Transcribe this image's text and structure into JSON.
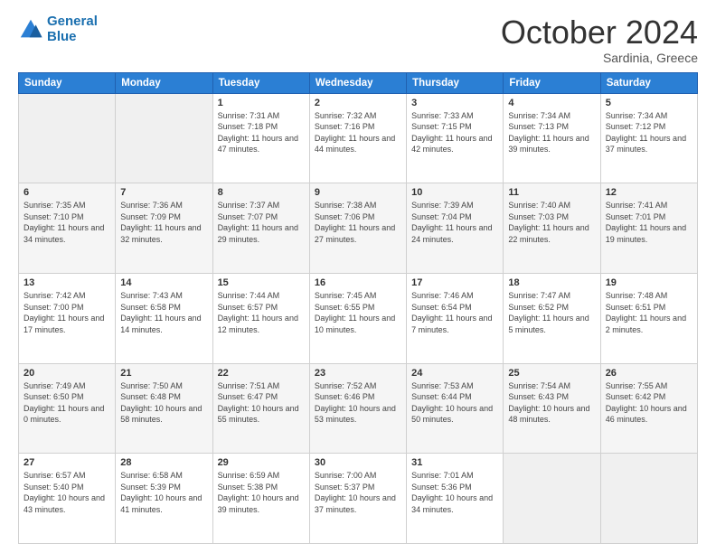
{
  "logo": {
    "line1": "General",
    "line2": "Blue"
  },
  "title": {
    "month": "October 2024",
    "location": "Sardinia, Greece"
  },
  "headers": [
    "Sunday",
    "Monday",
    "Tuesday",
    "Wednesday",
    "Thursday",
    "Friday",
    "Saturday"
  ],
  "weeks": [
    [
      {
        "day": "",
        "sunrise": "",
        "sunset": "",
        "daylight": ""
      },
      {
        "day": "",
        "sunrise": "",
        "sunset": "",
        "daylight": ""
      },
      {
        "day": "1",
        "sunrise": "Sunrise: 7:31 AM",
        "sunset": "Sunset: 7:18 PM",
        "daylight": "Daylight: 11 hours and 47 minutes."
      },
      {
        "day": "2",
        "sunrise": "Sunrise: 7:32 AM",
        "sunset": "Sunset: 7:16 PM",
        "daylight": "Daylight: 11 hours and 44 minutes."
      },
      {
        "day": "3",
        "sunrise": "Sunrise: 7:33 AM",
        "sunset": "Sunset: 7:15 PM",
        "daylight": "Daylight: 11 hours and 42 minutes."
      },
      {
        "day": "4",
        "sunrise": "Sunrise: 7:34 AM",
        "sunset": "Sunset: 7:13 PM",
        "daylight": "Daylight: 11 hours and 39 minutes."
      },
      {
        "day": "5",
        "sunrise": "Sunrise: 7:34 AM",
        "sunset": "Sunset: 7:12 PM",
        "daylight": "Daylight: 11 hours and 37 minutes."
      }
    ],
    [
      {
        "day": "6",
        "sunrise": "Sunrise: 7:35 AM",
        "sunset": "Sunset: 7:10 PM",
        "daylight": "Daylight: 11 hours and 34 minutes."
      },
      {
        "day": "7",
        "sunrise": "Sunrise: 7:36 AM",
        "sunset": "Sunset: 7:09 PM",
        "daylight": "Daylight: 11 hours and 32 minutes."
      },
      {
        "day": "8",
        "sunrise": "Sunrise: 7:37 AM",
        "sunset": "Sunset: 7:07 PM",
        "daylight": "Daylight: 11 hours and 29 minutes."
      },
      {
        "day": "9",
        "sunrise": "Sunrise: 7:38 AM",
        "sunset": "Sunset: 7:06 PM",
        "daylight": "Daylight: 11 hours and 27 minutes."
      },
      {
        "day": "10",
        "sunrise": "Sunrise: 7:39 AM",
        "sunset": "Sunset: 7:04 PM",
        "daylight": "Daylight: 11 hours and 24 minutes."
      },
      {
        "day": "11",
        "sunrise": "Sunrise: 7:40 AM",
        "sunset": "Sunset: 7:03 PM",
        "daylight": "Daylight: 11 hours and 22 minutes."
      },
      {
        "day": "12",
        "sunrise": "Sunrise: 7:41 AM",
        "sunset": "Sunset: 7:01 PM",
        "daylight": "Daylight: 11 hours and 19 minutes."
      }
    ],
    [
      {
        "day": "13",
        "sunrise": "Sunrise: 7:42 AM",
        "sunset": "Sunset: 7:00 PM",
        "daylight": "Daylight: 11 hours and 17 minutes."
      },
      {
        "day": "14",
        "sunrise": "Sunrise: 7:43 AM",
        "sunset": "Sunset: 6:58 PM",
        "daylight": "Daylight: 11 hours and 14 minutes."
      },
      {
        "day": "15",
        "sunrise": "Sunrise: 7:44 AM",
        "sunset": "Sunset: 6:57 PM",
        "daylight": "Daylight: 11 hours and 12 minutes."
      },
      {
        "day": "16",
        "sunrise": "Sunrise: 7:45 AM",
        "sunset": "Sunset: 6:55 PM",
        "daylight": "Daylight: 11 hours and 10 minutes."
      },
      {
        "day": "17",
        "sunrise": "Sunrise: 7:46 AM",
        "sunset": "Sunset: 6:54 PM",
        "daylight": "Daylight: 11 hours and 7 minutes."
      },
      {
        "day": "18",
        "sunrise": "Sunrise: 7:47 AM",
        "sunset": "Sunset: 6:52 PM",
        "daylight": "Daylight: 11 hours and 5 minutes."
      },
      {
        "day": "19",
        "sunrise": "Sunrise: 7:48 AM",
        "sunset": "Sunset: 6:51 PM",
        "daylight": "Daylight: 11 hours and 2 minutes."
      }
    ],
    [
      {
        "day": "20",
        "sunrise": "Sunrise: 7:49 AM",
        "sunset": "Sunset: 6:50 PM",
        "daylight": "Daylight: 11 hours and 0 minutes."
      },
      {
        "day": "21",
        "sunrise": "Sunrise: 7:50 AM",
        "sunset": "Sunset: 6:48 PM",
        "daylight": "Daylight: 10 hours and 58 minutes."
      },
      {
        "day": "22",
        "sunrise": "Sunrise: 7:51 AM",
        "sunset": "Sunset: 6:47 PM",
        "daylight": "Daylight: 10 hours and 55 minutes."
      },
      {
        "day": "23",
        "sunrise": "Sunrise: 7:52 AM",
        "sunset": "Sunset: 6:46 PM",
        "daylight": "Daylight: 10 hours and 53 minutes."
      },
      {
        "day": "24",
        "sunrise": "Sunrise: 7:53 AM",
        "sunset": "Sunset: 6:44 PM",
        "daylight": "Daylight: 10 hours and 50 minutes."
      },
      {
        "day": "25",
        "sunrise": "Sunrise: 7:54 AM",
        "sunset": "Sunset: 6:43 PM",
        "daylight": "Daylight: 10 hours and 48 minutes."
      },
      {
        "day": "26",
        "sunrise": "Sunrise: 7:55 AM",
        "sunset": "Sunset: 6:42 PM",
        "daylight": "Daylight: 10 hours and 46 minutes."
      }
    ],
    [
      {
        "day": "27",
        "sunrise": "Sunrise: 6:57 AM",
        "sunset": "Sunset: 5:40 PM",
        "daylight": "Daylight: 10 hours and 43 minutes."
      },
      {
        "day": "28",
        "sunrise": "Sunrise: 6:58 AM",
        "sunset": "Sunset: 5:39 PM",
        "daylight": "Daylight: 10 hours and 41 minutes."
      },
      {
        "day": "29",
        "sunrise": "Sunrise: 6:59 AM",
        "sunset": "Sunset: 5:38 PM",
        "daylight": "Daylight: 10 hours and 39 minutes."
      },
      {
        "day": "30",
        "sunrise": "Sunrise: 7:00 AM",
        "sunset": "Sunset: 5:37 PM",
        "daylight": "Daylight: 10 hours and 37 minutes."
      },
      {
        "day": "31",
        "sunrise": "Sunrise: 7:01 AM",
        "sunset": "Sunset: 5:36 PM",
        "daylight": "Daylight: 10 hours and 34 minutes."
      },
      {
        "day": "",
        "sunrise": "",
        "sunset": "",
        "daylight": ""
      },
      {
        "day": "",
        "sunrise": "",
        "sunset": "",
        "daylight": ""
      }
    ]
  ]
}
